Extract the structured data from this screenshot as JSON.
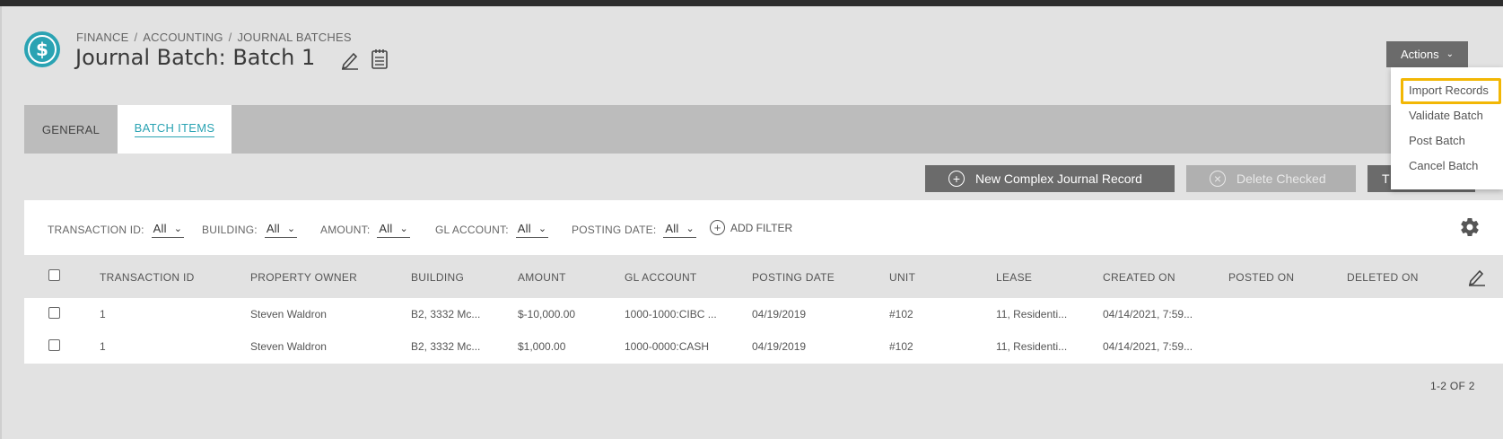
{
  "breadcrumb": {
    "items": [
      "FINANCE",
      "ACCOUNTING",
      "JOURNAL BATCHES"
    ],
    "separator": "/"
  },
  "page": {
    "title": "Journal Batch: Batch 1"
  },
  "actions": {
    "label": "Actions",
    "menu": [
      "Import Records",
      "Validate Batch",
      "Post Batch",
      "Cancel Batch"
    ]
  },
  "tabs": [
    {
      "label": "GENERAL"
    },
    {
      "label": "BATCH ITEMS"
    }
  ],
  "buttons": {
    "new_complex": "New Complex Journal Record",
    "delete_checked": "Delete Checked",
    "third": "T"
  },
  "filters": [
    {
      "label": "TRANSACTION ID:",
      "value": "All"
    },
    {
      "label": "BUILDING:",
      "value": "All"
    },
    {
      "label": "AMOUNT:",
      "value": "All"
    },
    {
      "label": "GL ACCOUNT:",
      "value": "All"
    },
    {
      "label": "POSTING DATE:",
      "value": "All"
    }
  ],
  "add_filter": "ADD FILTER",
  "table": {
    "columns": [
      "TRANSACTION ID",
      "PROPERTY OWNER",
      "BUILDING",
      "AMOUNT",
      "GL ACCOUNT",
      "POSTING DATE",
      "UNIT",
      "LEASE",
      "CREATED ON",
      "POSTED ON",
      "DELETED ON"
    ],
    "rows": [
      {
        "transaction_id": "1",
        "property_owner": "Steven Waldron",
        "building": "B2, 3332 Mc...",
        "amount": "$-10,000.00",
        "gl_account": "1000-1000:CIBC ...",
        "posting_date": "04/19/2019",
        "unit": "#102",
        "lease": "11, Residenti...",
        "created_on": "04/14/2021, 7:59...",
        "posted_on": "",
        "deleted_on": ""
      },
      {
        "transaction_id": "1",
        "property_owner": "Steven Waldron",
        "building": "B2, 3332 Mc...",
        "amount": "$1,000.00",
        "gl_account": "1000-0000:CASH",
        "posting_date": "04/19/2019",
        "unit": "#102",
        "lease": "11, Residenti...",
        "created_on": "04/14/2021, 7:59...",
        "posted_on": "",
        "deleted_on": ""
      }
    ]
  },
  "pager": "1-2 OF 2",
  "colors": {
    "accent": "#2aa3b3",
    "button": "#6b6b6b",
    "highlight": "#f2b705"
  }
}
